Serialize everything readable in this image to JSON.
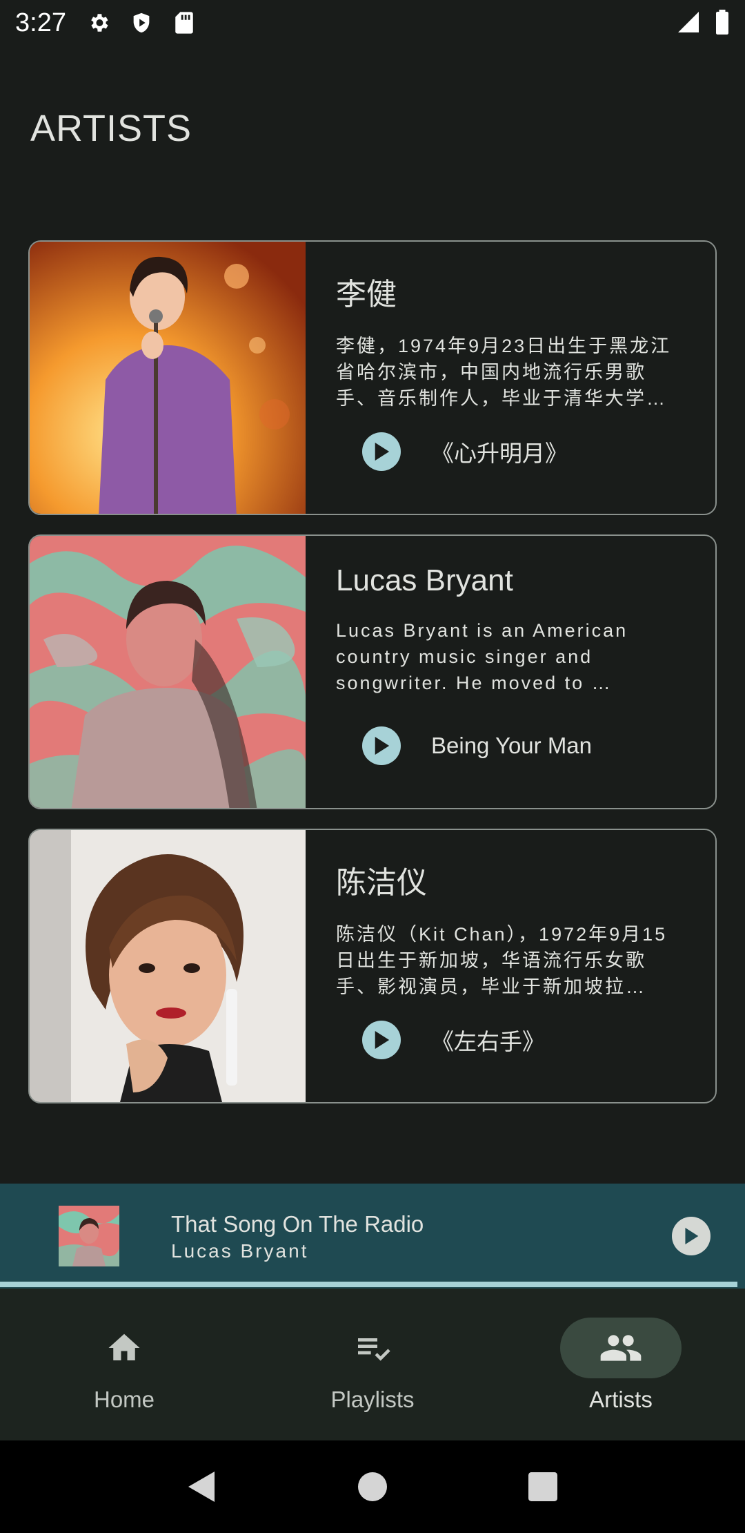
{
  "status_bar": {
    "time": "3:27",
    "icons": [
      "settings-icon",
      "shield-icon",
      "sd-card-icon"
    ],
    "right_icons": [
      "signal-icon",
      "battery-icon"
    ]
  },
  "page": {
    "title": "ARTISTS"
  },
  "artists": [
    {
      "name": "李健",
      "bio": "李健，1974年9月23日出生于黑龙江省哈尔滨市，中国内地流行乐男歌手、音乐制作人，毕业于清华大学…",
      "song": "《心升明月》",
      "photo_colors": [
        "#f6b04a",
        "#c75a1a",
        "#7a3d8a"
      ]
    },
    {
      "name": "Lucas Bryant",
      "bio": "Lucas Bryant is an American country music singer and songwriter. He moved to …",
      "song": "Being Your Man",
      "photo_colors": [
        "#e87878",
        "#6fbfa9",
        "#b8a0a0"
      ]
    },
    {
      "name": "陈洁仪",
      "bio": "陈洁仪（Kit Chan），1972年9月15日出生于新加坡，华语流行乐女歌手、影视演员，毕业于新加坡拉…",
      "song": "《左右手》",
      "photo_colors": [
        "#e9e6e2",
        "#5a3520",
        "#1b1b1b"
      ]
    }
  ],
  "mini_player": {
    "title": "That Song On The Radio",
    "artist": "Lucas Bryant",
    "progress": 0.99
  },
  "bottom_nav": {
    "items": [
      {
        "label": "Home",
        "icon": "home-icon",
        "active": false
      },
      {
        "label": "Playlists",
        "icon": "playlist-check-icon",
        "active": false
      },
      {
        "label": "Artists",
        "icon": "people-icon",
        "active": true
      }
    ]
  },
  "system_nav": [
    "back-icon",
    "home-circle-icon",
    "recents-icon"
  ],
  "colors": {
    "background": "#191c1a",
    "accent": "#a7d2d7",
    "mini_player_bg": "#1f4a52",
    "nav_bg": "#1d241f",
    "nav_active_pill": "#3a4a40"
  }
}
